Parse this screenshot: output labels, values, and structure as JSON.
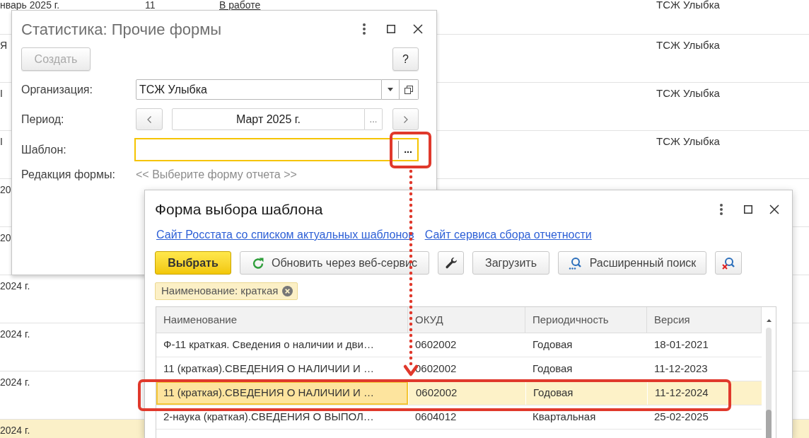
{
  "background_list": {
    "rows": [
      {
        "selected": false,
        "period": "нварь 2025 г.",
        "column_2": "11",
        "status": "В работе",
        "organization": "ТСЖ Улыбка"
      },
      {
        "selected": false,
        "period": "Я",
        "organization": "ТСЖ Улыбка"
      },
      {
        "selected": false,
        "period": "I",
        "organization": "ТСЖ Улыбка"
      },
      {
        "selected": false,
        "period": "I",
        "organization": "ТСЖ Улыбка"
      },
      {
        "selected": false,
        "period": "20"
      },
      {
        "selected": false,
        "period": "20"
      },
      {
        "selected": false,
        "period": "2024 г."
      },
      {
        "selected": false,
        "period": "2024 г."
      },
      {
        "selected": false,
        "period": "2024 г."
      },
      {
        "selected": true,
        "period": "2024 г."
      }
    ]
  },
  "statistics_window": {
    "title": "Статистика: Прочие формы",
    "create_button": {
      "label": "Создать",
      "disabled": true
    },
    "help_button": "?",
    "organization": {
      "label": "Организация:",
      "value": "ТСЖ Улыбка"
    },
    "period": {
      "label": "Период:",
      "value": "Март 2025 г.",
      "choice_button": "..."
    },
    "template": {
      "label": "Шаблон:",
      "focused": true,
      "choice_button": "..."
    },
    "form_revision": {
      "label": "Редакция формы:",
      "hint": "<< Выберите форму отчета >>"
    }
  },
  "template_window": {
    "title": "Форма выбора шаблона",
    "links": [
      "Сайт Росстата со списком актуальных шаблонов",
      "Сайт сервиса сбора отчетности"
    ],
    "toolbar": [
      {
        "kind": "primary",
        "label": "Выбрать"
      },
      {
        "kind": "refresh",
        "label": "Обновить через веб-сервис"
      },
      {
        "kind": "settings"
      },
      {
        "kind": "plain",
        "label": "Загрузить"
      },
      {
        "kind": "search",
        "label": "Расширенный поиск"
      },
      {
        "kind": "clear_search"
      }
    ],
    "filter": {
      "label": "Наименование: краткая"
    },
    "table": {
      "columns": [
        "Наименование",
        "ОКУД",
        "Периодичность",
        "Версия"
      ],
      "rows": [
        {
          "selected": false,
          "cells": [
            "Ф-11 краткая. Сведения о наличии и дви…",
            "0602002",
            "Годовая",
            "18-01-2021"
          ]
        },
        {
          "selected": false,
          "cells": [
            "11 (краткая).СВЕДЕНИЯ О НАЛИЧИИ И …",
            "0602002",
            "Годовая",
            "11-12-2023"
          ]
        },
        {
          "selected": true,
          "cells": [
            "11 (краткая).СВЕДЕНИЯ О НАЛИЧИИ И …",
            "0602002",
            "Годовая",
            "11-12-2024"
          ]
        },
        {
          "selected": false,
          "cells": [
            "2-наука (краткая).СВЕДЕНИЯ О ВЫПОЛ…",
            "0604012",
            "Квартальная",
            "25-02-2025"
          ]
        }
      ]
    }
  },
  "annotations": [
    {
      "kind": "frame"
    },
    {
      "kind": "arrow"
    },
    {
      "kind": "frame"
    }
  ]
}
